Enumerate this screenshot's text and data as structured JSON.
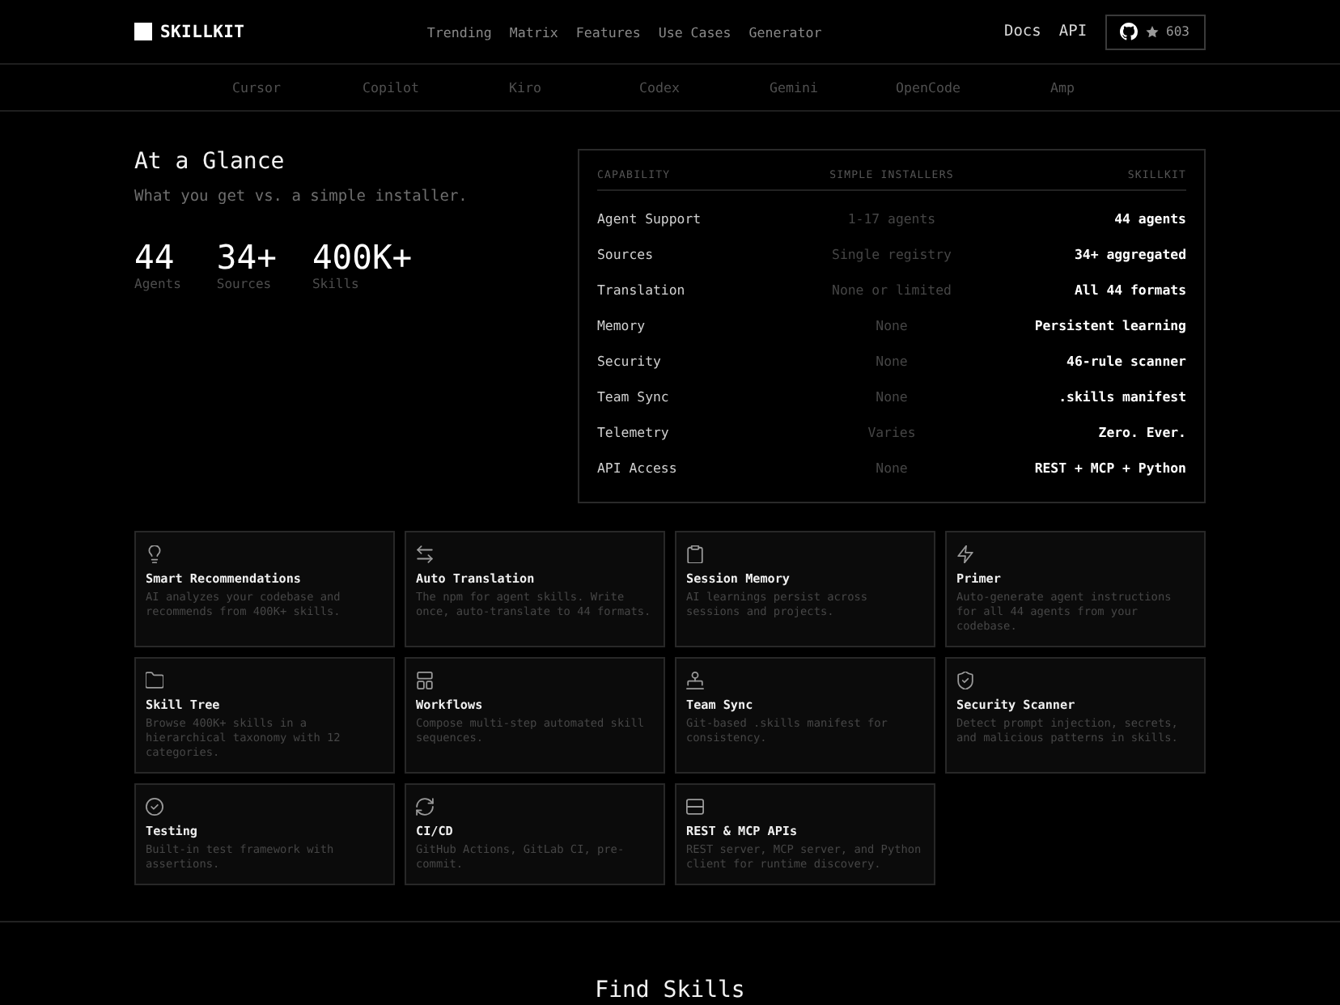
{
  "header": {
    "brand": "SKILLKIT",
    "nav": [
      "Trending",
      "Matrix",
      "Features",
      "Use Cases",
      "Generator"
    ],
    "links": [
      "Docs",
      "API"
    ],
    "github": {
      "stars": "603"
    }
  },
  "agents_strip": [
    "Cursor",
    "Copilot",
    "Kiro",
    "Codex",
    "Gemini",
    "OpenCode",
    "Amp"
  ],
  "glance": {
    "title": "At a Glance",
    "subtitle": "What you get vs. a simple installer.",
    "stats": [
      {
        "value": "44",
        "label": "Agents"
      },
      {
        "value": "34+",
        "label": "Sources"
      },
      {
        "value": "400K+",
        "label": "Skills"
      }
    ]
  },
  "comparison": {
    "columns": [
      "CAPABILITY",
      "SIMPLE INSTALLERS",
      "SKILLKIT"
    ],
    "rows": [
      {
        "capability": "Agent Support",
        "simple_installers": "1-17 agents",
        "skillkit": "44 agents"
      },
      {
        "capability": "Sources",
        "simple_installers": "Single registry",
        "skillkit": "34+ aggregated"
      },
      {
        "capability": "Translation",
        "simple_installers": "None or limited",
        "skillkit": "All 44 formats"
      },
      {
        "capability": "Memory",
        "simple_installers": "None",
        "skillkit": "Persistent learning"
      },
      {
        "capability": "Security",
        "simple_installers": "None",
        "skillkit": "46-rule scanner"
      },
      {
        "capability": "Team Sync",
        "simple_installers": "None",
        "skillkit": ".skills manifest"
      },
      {
        "capability": "Telemetry",
        "simple_installers": "Varies",
        "skillkit": "Zero. Ever."
      },
      {
        "capability": "API Access",
        "simple_installers": "None",
        "skillkit": "REST + MCP + Python"
      }
    ]
  },
  "features": [
    {
      "title": "Smart Recommendations",
      "description": "AI analyzes your codebase and recommends from 400K+ skills."
    },
    {
      "title": "Auto Translation",
      "description": "The npm for agent skills. Write once, auto-translate to 44 formats."
    },
    {
      "title": "Session Memory",
      "description": "AI learnings persist across sessions and projects."
    },
    {
      "title": "Primer",
      "description": "Auto-generate agent instructions for all 44 agents from your codebase."
    },
    {
      "title": "Skill Tree",
      "description": "Browse 400K+ skills in a hierarchical taxonomy with 12 categories."
    },
    {
      "title": "Workflows",
      "description": "Compose multi-step automated skill sequences."
    },
    {
      "title": "Team Sync",
      "description": "Git-based .skills manifest for consistency."
    },
    {
      "title": "Security Scanner",
      "description": "Detect prompt injection, secrets, and malicious patterns in skills."
    },
    {
      "title": "Testing",
      "description": "Built-in test framework with assertions."
    },
    {
      "title": "CI/CD",
      "description": "GitHub Actions, GitLab CI, pre-commit."
    },
    {
      "title": "REST & MCP APIs",
      "description": "REST server, MCP server, and Python client for runtime discovery."
    }
  ],
  "next_section": {
    "title": "Find Skills"
  }
}
